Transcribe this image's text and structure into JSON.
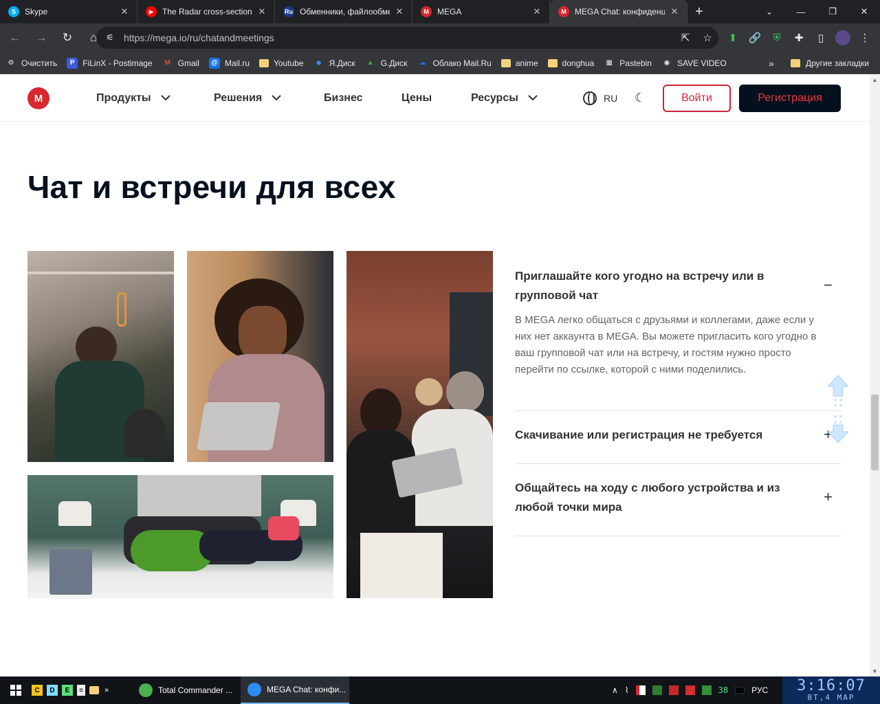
{
  "tabs": [
    {
      "title": "Skype",
      "icon": "skype-icon",
      "color": "#00aff0",
      "letter": "S"
    },
    {
      "title": "The Radar cross-section c",
      "icon": "youtube-icon",
      "color": "#ff0000",
      "letter": "▶"
    },
    {
      "title": "Обменники, файлообме",
      "icon": "ru-board-icon",
      "color": "#1a3a8a",
      "letter": "Ru"
    },
    {
      "title": "MEGA",
      "icon": "mega-icon",
      "color": "#d9272e",
      "letter": "M"
    },
    {
      "title": "MEGA Chat: конфиденц",
      "icon": "mega-icon",
      "color": "#d9272e",
      "letter": "M"
    }
  ],
  "address": {
    "url": "https://mega.io/ru/chatandmeetings"
  },
  "bookmarks": [
    {
      "label": "Очистить",
      "icon": "gear-icon",
      "glyph": "⚙",
      "bg": "transparent",
      "fg": "#e8eaed"
    },
    {
      "label": "FiLinX - Postimage",
      "icon": "postimage-icon",
      "glyph": "P",
      "bg": "#3b5bdb",
      "fg": "#fff"
    },
    {
      "label": "Gmail",
      "icon": "gmail-icon",
      "glyph": "M",
      "bg": "transparent",
      "fg": "#ea4335"
    },
    {
      "label": "Mail.ru",
      "icon": "mailru-icon",
      "glyph": "@",
      "bg": "#1a73e8",
      "fg": "#fff"
    },
    {
      "label": "Youtube",
      "icon": "folder-icon",
      "glyph": "",
      "bg": "#f5d27a",
      "fg": "#000"
    },
    {
      "label": "Я.Диск",
      "icon": "yadisk-icon",
      "glyph": "◆",
      "bg": "transparent",
      "fg": "#3d8bfd"
    },
    {
      "label": "G.Диск",
      "icon": "gdrive-icon",
      "glyph": "▲",
      "bg": "transparent",
      "fg": "#34a853"
    },
    {
      "label": "Облако Mail.Ru",
      "icon": "cloud-icon",
      "glyph": "☁",
      "bg": "transparent",
      "fg": "#1a73e8"
    },
    {
      "label": "anime",
      "icon": "folder-icon",
      "glyph": "",
      "bg": "#f5d27a",
      "fg": "#000"
    },
    {
      "label": "donghua",
      "icon": "folder-icon",
      "glyph": "",
      "bg": "#f5d27a",
      "fg": "#000"
    },
    {
      "label": "Pastebin",
      "icon": "pastebin-icon",
      "glyph": "▦",
      "bg": "transparent",
      "fg": "#e8eaed"
    },
    {
      "label": "SAVE VIDEO",
      "icon": "globe-icon",
      "glyph": "◉",
      "bg": "transparent",
      "fg": "#e8eaed"
    }
  ],
  "bookmarks_more": "»",
  "bookmarks_other": "Другие закладки",
  "site": {
    "logo": "M",
    "nav": [
      {
        "label": "Продукты",
        "dropdown": true
      },
      {
        "label": "Решения",
        "dropdown": true
      },
      {
        "label": "Бизнес",
        "dropdown": false
      },
      {
        "label": "Цены",
        "dropdown": false
      },
      {
        "label": "Ресурсы",
        "dropdown": true
      }
    ],
    "lang": "RU",
    "login": "Войти",
    "register": "Регистрация"
  },
  "heading": "Чат и встречи для всех",
  "accordion": [
    {
      "title": "Приглашайте кого угодно на встречу или в групповой чат",
      "expanded": true,
      "body": "В MEGA легко общаться с друзьями и коллегами, даже если у них нет аккаунта в MEGA. Вы можете пригласить кого угодно в ваш групповой чат или на встречу, и гостям нужно просто перейти по ссылке, которой с ними поделились."
    },
    {
      "title": "Скачивание или регистрация не требуется",
      "expanded": false,
      "body": ""
    },
    {
      "title": "Общайтесь на ходу с любого устройства и из любой точки мира",
      "expanded": false,
      "body": ""
    }
  ],
  "signs": {
    "expanded": "−",
    "collapsed": "+"
  },
  "taskbar": {
    "quick": [
      {
        "label": "C",
        "bg": "#f0c419"
      },
      {
        "label": "D",
        "bg": "#7fdcff"
      },
      {
        "label": "E",
        "bg": "#5de07a"
      }
    ],
    "tasks": [
      {
        "label": "Total Commander ...",
        "color": "#4caf50"
      },
      {
        "label": "MEGA Chat: конфи...",
        "color": "#2d8cf0"
      }
    ],
    "tray_num": "38",
    "lang": "РУС",
    "time": "3:16:07",
    "date": "ВТ,4 МАР"
  }
}
